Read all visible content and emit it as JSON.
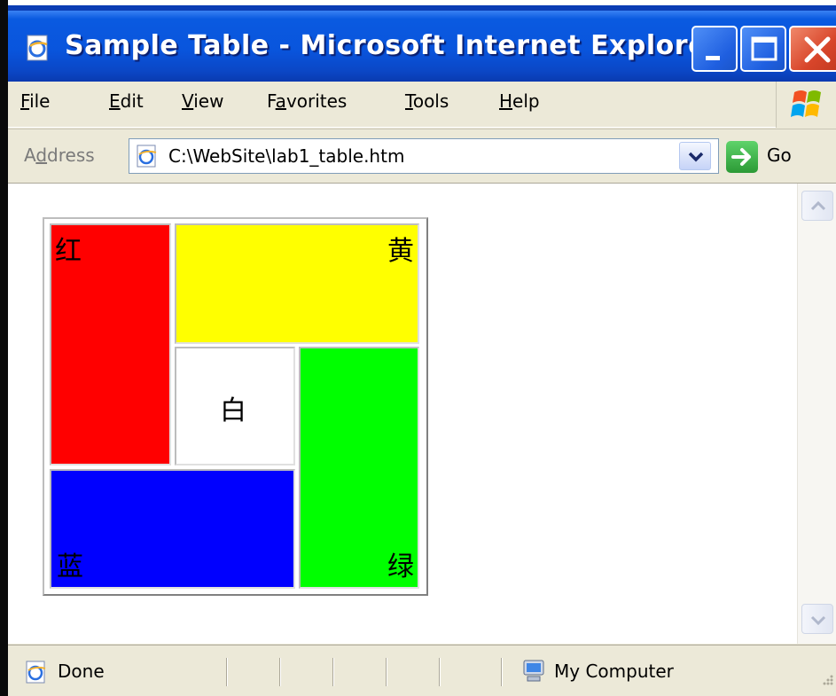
{
  "window": {
    "title": "Sample Table - Microsoft Internet Explorer"
  },
  "menu": {
    "items": [
      {
        "accel": "F",
        "rest": "ile"
      },
      {
        "accel": "E",
        "rest": "dit"
      },
      {
        "accel": "V",
        "rest": "iew"
      },
      {
        "pre": "F",
        "accel": "a",
        "rest": "vorites"
      },
      {
        "accel": "T",
        "rest": "ools"
      },
      {
        "accel": "H",
        "rest": "elp"
      }
    ]
  },
  "address": {
    "label_pre": "A",
    "label_accel": "d",
    "label_rest": "dress",
    "url": "C:\\WebSite\\lab1_table.htm",
    "go_label": "Go"
  },
  "table": {
    "cells": {
      "red": "红",
      "yellow": "黄",
      "white": "白",
      "green": "绿",
      "blue": "蓝"
    }
  },
  "status": {
    "text": "Done",
    "zone": "My Computer"
  },
  "colors": {
    "title_bar": "#0955dd",
    "red": "#ff0000",
    "yellow": "#ffff00",
    "white": "#ffffff",
    "green": "#00ff00",
    "blue": "#0000ff"
  },
  "icons": {
    "title": "ie-page-icon",
    "minimize": "minimize-icon",
    "maximize": "maximize-icon",
    "close": "close-icon",
    "windows_logo": "windows-flag-icon",
    "address": "ie-page-icon",
    "dropdown": "chevron-down-icon",
    "go": "go-arrow-icon",
    "scroll_up": "scroll-up-icon",
    "scroll_down": "scroll-down-icon",
    "status_page": "ie-page-icon",
    "zone": "my-computer-icon",
    "grip": "resize-grip-icon"
  }
}
